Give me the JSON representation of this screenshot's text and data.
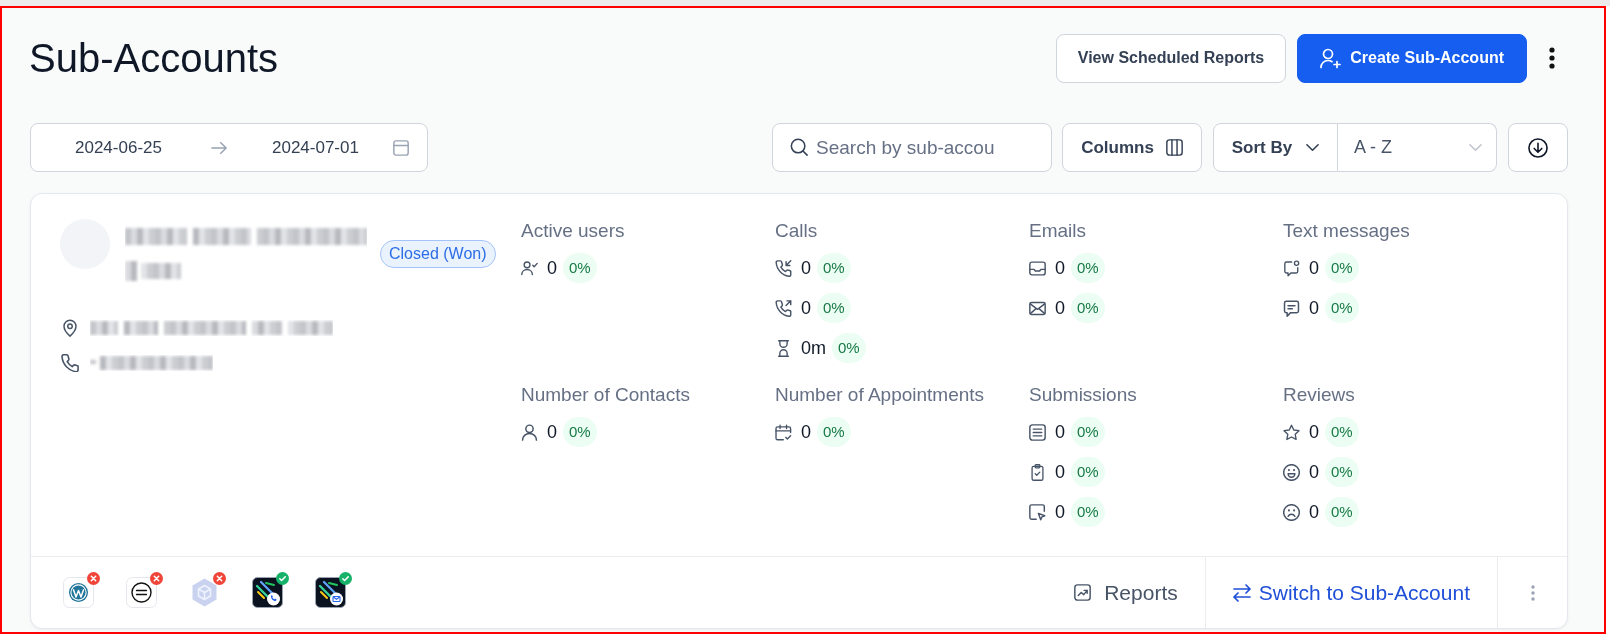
{
  "header": {
    "title": "Sub-Accounts",
    "buttons": [
      {
        "kind": "outline",
        "label": "View Scheduled Reports"
      },
      {
        "kind": "primary",
        "label": "Create Sub-Account"
      }
    ]
  },
  "toolbar": {
    "date_range": {
      "start": "2024-06-25",
      "end": "2024-07-01"
    },
    "search": {
      "placeholder": "Search by sub-accou"
    },
    "columns_button": "Columns",
    "sort_button": "Sort By",
    "sort_order": "A - Z"
  },
  "accounts": [
    {
      "status": "Closed (Won)",
      "details": [
        {
          "kind": "address"
        },
        {
          "kind": "phone"
        }
      ],
      "metrics": [
        {
          "title": "Active users",
          "items": [
            {
              "kind": "users",
              "value": "0",
              "change": "0%"
            }
          ]
        },
        {
          "title": "Calls",
          "items": [
            {
              "kind": "incoming",
              "value": "0",
              "change": "0%"
            },
            {
              "kind": "outgoing",
              "value": "0",
              "change": "0%"
            },
            {
              "kind": "duration",
              "value": "0m",
              "change": "0%"
            }
          ]
        },
        {
          "title": "Emails",
          "items": [
            {
              "kind": "inbox",
              "value": "0",
              "change": "0%"
            },
            {
              "kind": "envelope",
              "value": "0",
              "change": "0%"
            }
          ]
        },
        {
          "title": "Text messages",
          "items": [
            {
              "kind": "chat_dot",
              "value": "0",
              "change": "0%"
            },
            {
              "kind": "chat_text",
              "value": "0",
              "change": "0%"
            }
          ]
        },
        {
          "title": "Number of Contacts",
          "items": [
            {
              "kind": "contact",
              "value": "0",
              "change": "0%"
            }
          ]
        },
        {
          "title": "Number of Appointments",
          "items": [
            {
              "kind": "calendar",
              "value": "0",
              "change": "0%"
            }
          ]
        },
        {
          "title": "Submissions",
          "items": [
            {
              "kind": "form",
              "value": "0",
              "change": "0%"
            },
            {
              "kind": "survey",
              "value": "0",
              "change": "0%"
            },
            {
              "kind": "click",
              "value": "0",
              "change": "0%"
            }
          ]
        },
        {
          "title": "Reviews",
          "items": [
            {
              "kind": "star",
              "value": "0",
              "change": "0%"
            },
            {
              "kind": "happy",
              "value": "0",
              "change": "0%"
            },
            {
              "kind": "sad",
              "value": "0",
              "change": "0%"
            }
          ]
        }
      ],
      "integrations": [
        {
          "kind": "round",
          "connected": false
        },
        {
          "kind": "ring",
          "connected": false
        },
        {
          "kind": "cube",
          "connected": false
        },
        {
          "kind": "phone_app",
          "connected": true
        },
        {
          "kind": "mail_app",
          "connected": true
        }
      ],
      "actions": [
        {
          "kind": "reports",
          "label": "Reports"
        },
        {
          "kind": "switch",
          "label": "Switch to Sub-Account"
        }
      ]
    }
  ]
}
